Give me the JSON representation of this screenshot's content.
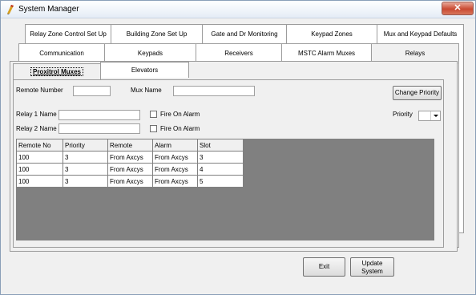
{
  "window": {
    "title": "System Manager",
    "close_label": "✕"
  },
  "tabs_row1": [
    {
      "label": "Relay Zone Control Set Up"
    },
    {
      "label": "Building Zone Set Up"
    },
    {
      "label": "Gate and Dr Monitoring"
    },
    {
      "label": "Keypad Zones"
    },
    {
      "label": "Mux and Keypad Defaults"
    }
  ],
  "tabs_row2": [
    {
      "label": "Communication"
    },
    {
      "label": "Keypads"
    },
    {
      "label": "Receivers"
    },
    {
      "label": "MSTC Alarm Muxes"
    },
    {
      "label": "Relays",
      "selected": true
    }
  ],
  "subtabs": [
    {
      "label": "Proxitrol Muxes",
      "selected": true
    },
    {
      "label": "Elevators"
    }
  ],
  "form": {
    "remote_number_label": "Remote Number",
    "remote_number_value": "",
    "mux_name_label": "Mux  Name",
    "mux_name_value": "",
    "change_priority_label": "Change Priority",
    "relay1_label": "Relay 1 Name",
    "relay1_value": "",
    "relay2_label": "Relay 2 Name",
    "relay2_value": "",
    "fire_on_alarm_label": "Fire On Alarm",
    "priority_label": "Priority",
    "priority_value": ""
  },
  "table": {
    "columns": [
      "Remote No",
      "Priority",
      "Remote",
      "Alarm",
      "Slot"
    ],
    "rows": [
      [
        "100",
        "3",
        "From Axcys",
        "From Axcys",
        "3"
      ],
      [
        "100",
        "3",
        "From Axcys",
        "From Axcys",
        "4"
      ],
      [
        "100",
        "3",
        "From Axcys",
        "From Axcys",
        "5"
      ]
    ]
  },
  "footer": {
    "exit_label": "Exit",
    "update_line1": "Update",
    "update_line2": "System"
  }
}
